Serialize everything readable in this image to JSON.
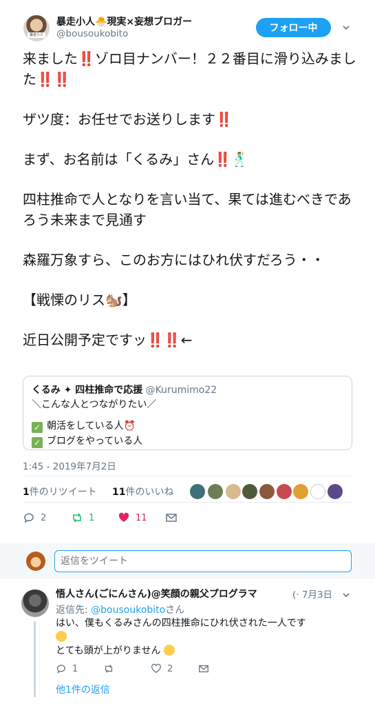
{
  "author": {
    "name": "暴走小人🐣現実×妄想ブロガー",
    "handle": "@bousoukobito",
    "avatar_tag": "暴走小人"
  },
  "follow_label": "フォロー中",
  "tweet": {
    "paragraphs": [
      "来ました‼️ゾロ目ナンバー！２２番目に滑り込みました‼️‼️",
      "ザツ度：お任せでお送りします‼️",
      "まず、お名前は「くるみ」さん‼️🕺",
      "四柱推命で人となりを言い当て、果ては進むべきであろう未来まで見通す",
      "森羅万象すら、このお方にはひれ伏すだろう・・",
      "【戦慄のリス🐿️】",
      "近日公開予定ですッ‼️‼️←"
    ],
    "time": "1:45 - 2019年7月2日"
  },
  "quote": {
    "name": "くるみ ✦ 四柱推命で応援",
    "handle": "@Kurumimo22",
    "line1": "＼こんな人とつながりたい／",
    "line2": "朝活をしている人⏰",
    "line3": "ブログをやっている人"
  },
  "stats": {
    "retweets": "1",
    "retweets_label": "件のリツイート",
    "likes": "11",
    "likes_label": "件のいいね"
  },
  "actions": {
    "reply_count": "2",
    "retweet_count": "1",
    "like_count": "11"
  },
  "compose": {
    "placeholder": "返信をツイート"
  },
  "reply": {
    "name": "悟人さん(ごにんさん)@笑顔の親父プログラマ",
    "date": "(· 7月3日",
    "reply_to_prefix": "返信先: ",
    "reply_to_handle": "@bousoukobito",
    "reply_to_suffix": "さん",
    "line1": "はい、僕もくるみさんの四柱推命にひれ伏された一人です",
    "line2": "とても頭が上がりません",
    "reply_count": "1",
    "retweet_count": "",
    "like_count": "2",
    "more_label": "他1件の返信"
  },
  "colors": {
    "accent": "#1da1f2",
    "like": "#e0245e",
    "retweet": "#17bf63",
    "muted": "#657786"
  }
}
